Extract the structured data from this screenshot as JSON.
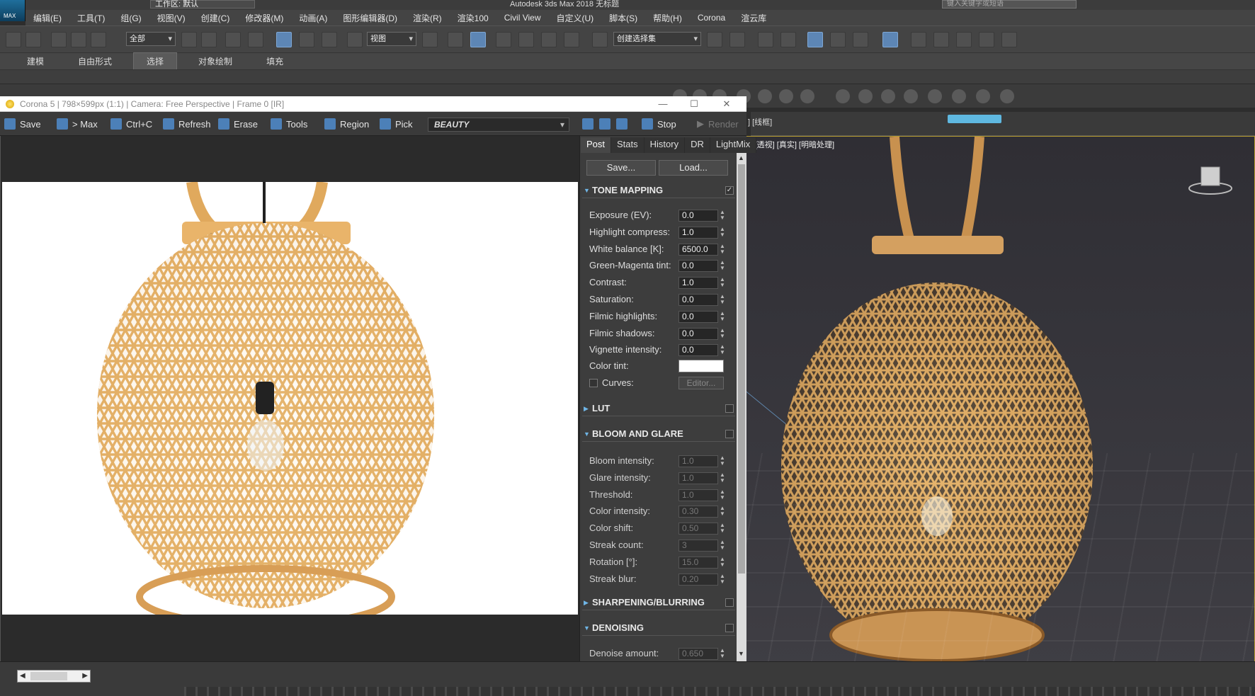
{
  "app": {
    "logo_text": "MAX",
    "workspace": "工作区: 默认",
    "title": "Autodesk 3ds Max 2018    无标题",
    "help_search_placeholder": "键入关键字或短语"
  },
  "menu": [
    "编辑(E)",
    "工具(T)",
    "组(G)",
    "视图(V)",
    "创建(C)",
    "修改器(M)",
    "动画(A)",
    "图形编辑器(D)",
    "渲染(R)",
    "渲染100",
    "Civil View",
    "自定义(U)",
    "脚本(S)",
    "帮助(H)",
    "Corona",
    "渲云库"
  ],
  "maintoolbar": {
    "selection_filter": "全部",
    "ref_coord": "视图",
    "named_selection": "创建选择集"
  },
  "ribbon": {
    "tabs": [
      {
        "label": "建模",
        "active": false
      },
      {
        "label": "自由形式",
        "active": false
      },
      {
        "label": "选择",
        "active": true
      },
      {
        "label": "对象绘制",
        "active": false
      },
      {
        "label": "填充",
        "active": false
      }
    ]
  },
  "viewport": {
    "label": "[+] [透视] [真实] [明暗处理]",
    "top_label": "] [线框]",
    "background_color": "#36353b",
    "border_color": "#b59b2f"
  },
  "vfb": {
    "title": "Corona 5 | 798×599px (1:1) | Camera: Free Perspective | Frame 0 [IR]",
    "toolbar": {
      "save": "Save",
      "to_max": "> Max",
      "ctrl_c": "Ctrl+C",
      "refresh": "Refresh",
      "erase": "Erase",
      "tools": "Tools",
      "region": "Region",
      "pick": "Pick",
      "channel": "BEAUTY",
      "stop": "Stop",
      "render": "Render"
    },
    "post_tabs": [
      {
        "label": "Post",
        "active": true
      },
      {
        "label": "Stats",
        "active": false
      },
      {
        "label": "History",
        "active": false
      },
      {
        "label": "DR",
        "active": false
      },
      {
        "label": "LightMix",
        "active": false
      }
    ],
    "buttons": {
      "save": "Save...",
      "load": "Load..."
    },
    "sections": {
      "tone_mapping": {
        "title": "TONE MAPPING",
        "checked": "✓"
      },
      "lut": {
        "title": "LUT"
      },
      "bloom": {
        "title": "BLOOM AND GLARE"
      },
      "sharpening": {
        "title": "SHARPENING/BLURRING"
      },
      "denoising": {
        "title": "DENOISING"
      }
    },
    "tone_mapping": [
      {
        "label": "Exposure (EV):",
        "value": "0.0"
      },
      {
        "label": "Highlight compress:",
        "value": "1.0"
      },
      {
        "label": "White balance [K]:",
        "value": "6500.0"
      },
      {
        "label": "Green-Magenta tint:",
        "value": "0.0"
      },
      {
        "label": "Contrast:",
        "value": "1.0"
      },
      {
        "label": "Saturation:",
        "value": "0.0"
      },
      {
        "label": "Filmic highlights:",
        "value": "0.0"
      },
      {
        "label": "Filmic shadows:",
        "value": "0.0"
      },
      {
        "label": "Vignette intensity:",
        "value": "0.0"
      }
    ],
    "color_tint_label": "Color tint:",
    "color_tint_value": "#ffffff",
    "curves_label": "Curves:",
    "curves_editor": "Editor...",
    "bloom": [
      {
        "label": "Bloom intensity:",
        "value": "1.0"
      },
      {
        "label": "Glare intensity:",
        "value": "1.0"
      },
      {
        "label": "Threshold:",
        "value": "1.0"
      },
      {
        "label": "Color intensity:",
        "value": "0.30"
      },
      {
        "label": "Color shift:",
        "value": "0.50"
      },
      {
        "label": "Streak count:",
        "value": "3"
      },
      {
        "label": "Rotation [°]:",
        "value": "15.0"
      },
      {
        "label": "Streak blur:",
        "value": "0.20"
      }
    ],
    "denoise": {
      "label": "Denoise amount:",
      "value": "0.650"
    }
  },
  "colors": {
    "bamboo": "#e2ad62",
    "bamboo_dark": "#b07a3a",
    "accent_blue": "#5d86b5"
  }
}
